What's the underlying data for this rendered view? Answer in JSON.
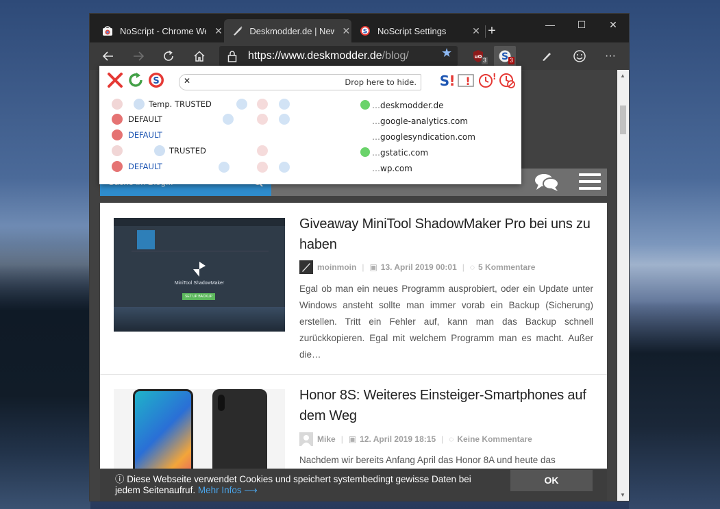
{
  "window": {
    "tabs": [
      {
        "label": "NoScript - Chrome Web Store",
        "close": "✕"
      },
      {
        "label": "Deskmodder.de | News, Tipps",
        "close": "✕"
      },
      {
        "label": "NoScript Settings",
        "close": "✕"
      }
    ],
    "new_tab": "+",
    "controls": {
      "minimize": "—",
      "maximize": "☐",
      "close": "✕"
    }
  },
  "toolbar": {
    "url_host": "https://www.deskmodder.de",
    "url_path": "/blog/",
    "ublock_badge": "3",
    "noscript_badge": "3",
    "menu_dots": "···"
  },
  "noscript_popup": {
    "drop_label": "Drop here to hide.",
    "drop_close": "✕",
    "presets": [
      "Temp. TRUSTED",
      "DEFAULT",
      "DEFAULT",
      "TRUSTED",
      "DEFAULT"
    ],
    "hosts": [
      "deskmodder.de",
      "google-analytics.com",
      "googlesyndication.com",
      "gstatic.com",
      "wp.com"
    ],
    "host_prefix": "…"
  },
  "site": {
    "search_placeholder": "Suche im Blog...",
    "posts": [
      {
        "title": "Giveaway MiniTool ShadowMaker Pro bei uns zu haben",
        "author": "moinmoin",
        "date": "13. April 2019 00:01",
        "comments": "5 Kommentare",
        "excerpt": "Egal ob man ein neues Programm ausprobiert, oder ein Update unter Windows ansteht sollte man immer vorab ein Backup (Sicherung) erstellen. Tritt ein Fehler auf, kann man das Backup schnell zurückkopieren. Egal mit welchem Programm man es macht. Außer die…",
        "thumb_caption": "MiniTool ShadowMaker",
        "thumb_button": "SET UP BACKUP"
      },
      {
        "title": "Honor 8S: Weiteres Einsteiger-Smartphones auf dem Weg",
        "author": "Mike",
        "date": "12. April 2019 18:15",
        "comments": "Keine Kommentare",
        "excerpt": "Nachdem wir bereits Anfang April das Honor 8A und heute das"
      }
    ],
    "cookie": {
      "text": "Diese Webseite verwendet Cookies und speichert systembedingt gewisse Daten bei jedem Seitenaufruf.",
      "more": "Mehr Infos ⟶",
      "ok": "OK"
    }
  },
  "colors": {
    "accent_blue": "#2e8ccd",
    "noscript_red": "#d32f2f",
    "noscript_green": "#43a047"
  }
}
